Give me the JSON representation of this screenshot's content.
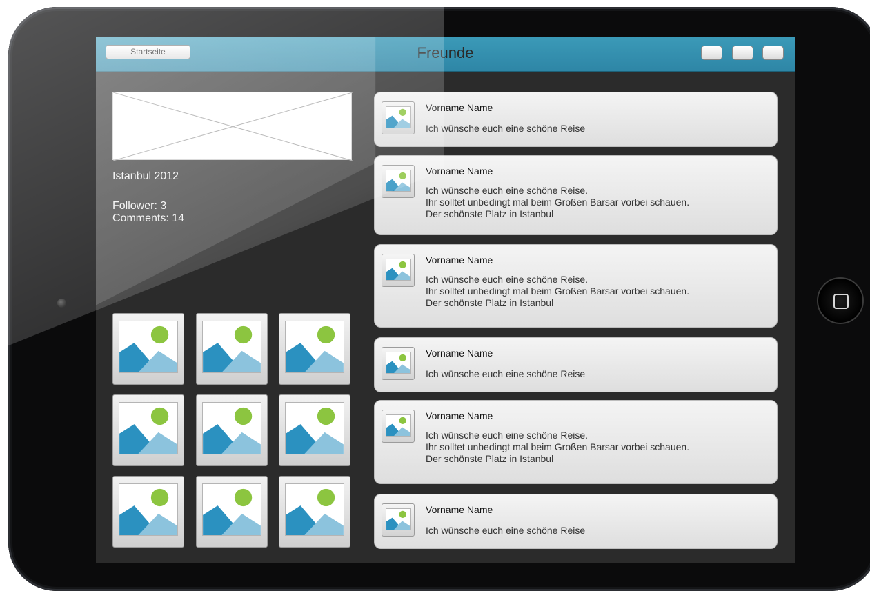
{
  "header": {
    "home_label": "Startseite",
    "title": "Freunde"
  },
  "album": {
    "title": "Istanbul 2012",
    "followers": "Follower: 3",
    "comments": "Comments: 14"
  },
  "image_placeholder_icon": "image-icon",
  "colors": {
    "header": "#3394b3",
    "screen": "#2b2b2b",
    "image_sun": "#8cc540",
    "image_mountain_dark": "#2b91c0",
    "image_mountain_light": "#8cc3dd"
  },
  "comments": [
    {
      "name": "Vorname Name",
      "lines": [
        "Ich wünsche euch eine schöne Reise"
      ]
    },
    {
      "name": "Vorname Name",
      "lines": [
        "Ich wünsche euch eine schöne Reise.",
        "Ihr solltet unbedingt mal beim Großen Barsar vorbei schauen.",
        "Der schönste Platz in Istanbul"
      ]
    },
    {
      "name": "Vorname Name",
      "lines": [
        "Ich wünsche euch eine schöne Reise.",
        "Ihr solltet unbedingt mal beim Großen Barsar vorbei schauen.",
        "Der schönste Platz in Istanbul"
      ]
    },
    {
      "name": "Vorname Name",
      "lines": [
        "Ich wünsche euch eine schöne Reise"
      ]
    },
    {
      "name": "Vorname Name",
      "lines": [
        "Ich wünsche euch eine schöne Reise.",
        "Ihr solltet unbedingt mal beim Großen Barsar vorbei schauen.",
        "Der schönste Platz in Istanbul"
      ]
    },
    {
      "name": "Vorname Name",
      "lines": [
        "Ich wünsche euch eine schöne Reise"
      ]
    }
  ]
}
